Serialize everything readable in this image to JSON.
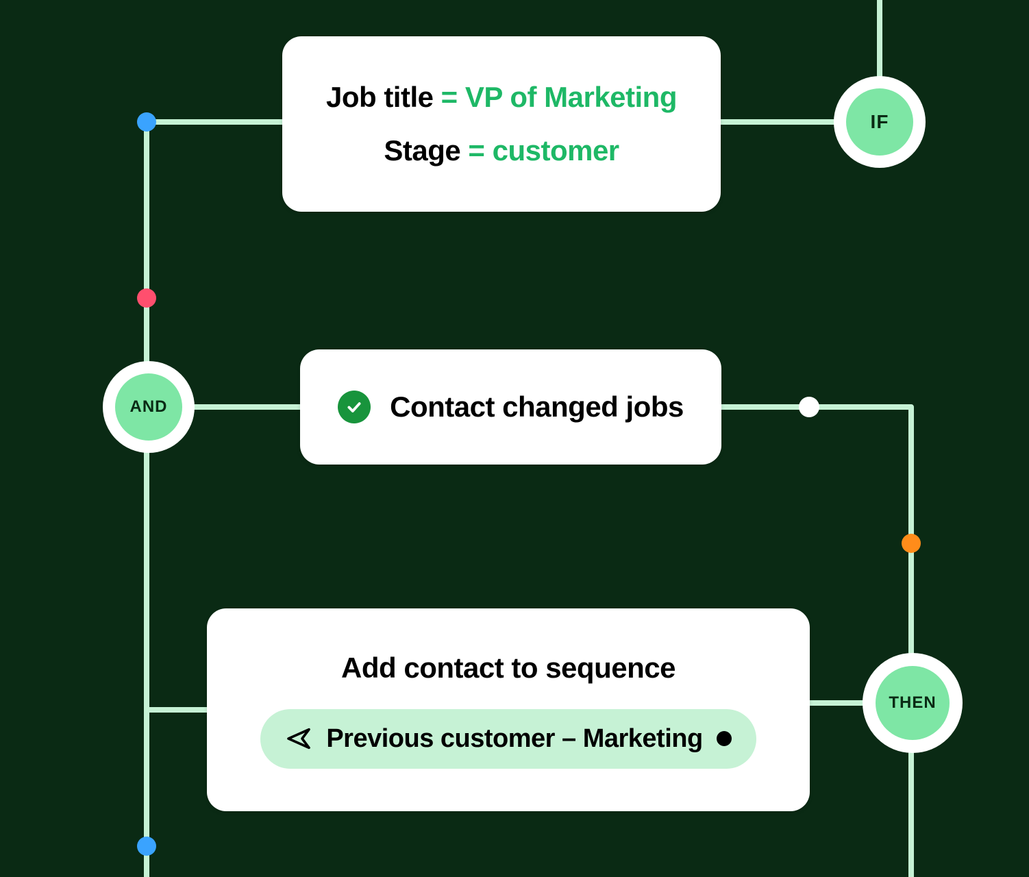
{
  "operators": {
    "if": "IF",
    "and": "AND",
    "then": "THEN"
  },
  "condition": {
    "line1": {
      "field": "Job title",
      "op": "=",
      "value": "VP of Marketing"
    },
    "line2": {
      "field": "Stage",
      "op": "=",
      "value": "customer"
    }
  },
  "event": {
    "label": "Contact changed jobs"
  },
  "action": {
    "title": "Add contact to sequence",
    "sequence_name": "Previous customer – Marketing"
  },
  "colors": {
    "bg": "#0a2a14",
    "line": "#c6f2d5",
    "accent_green": "#1eb866",
    "disc_fill": "#7ee6a5",
    "pill_bg": "#c6f2d5",
    "dot_blue": "#3aa3ff",
    "dot_pink": "#ff4f6e",
    "dot_orange": "#ff8c1a",
    "dot_white": "#ffffff"
  }
}
